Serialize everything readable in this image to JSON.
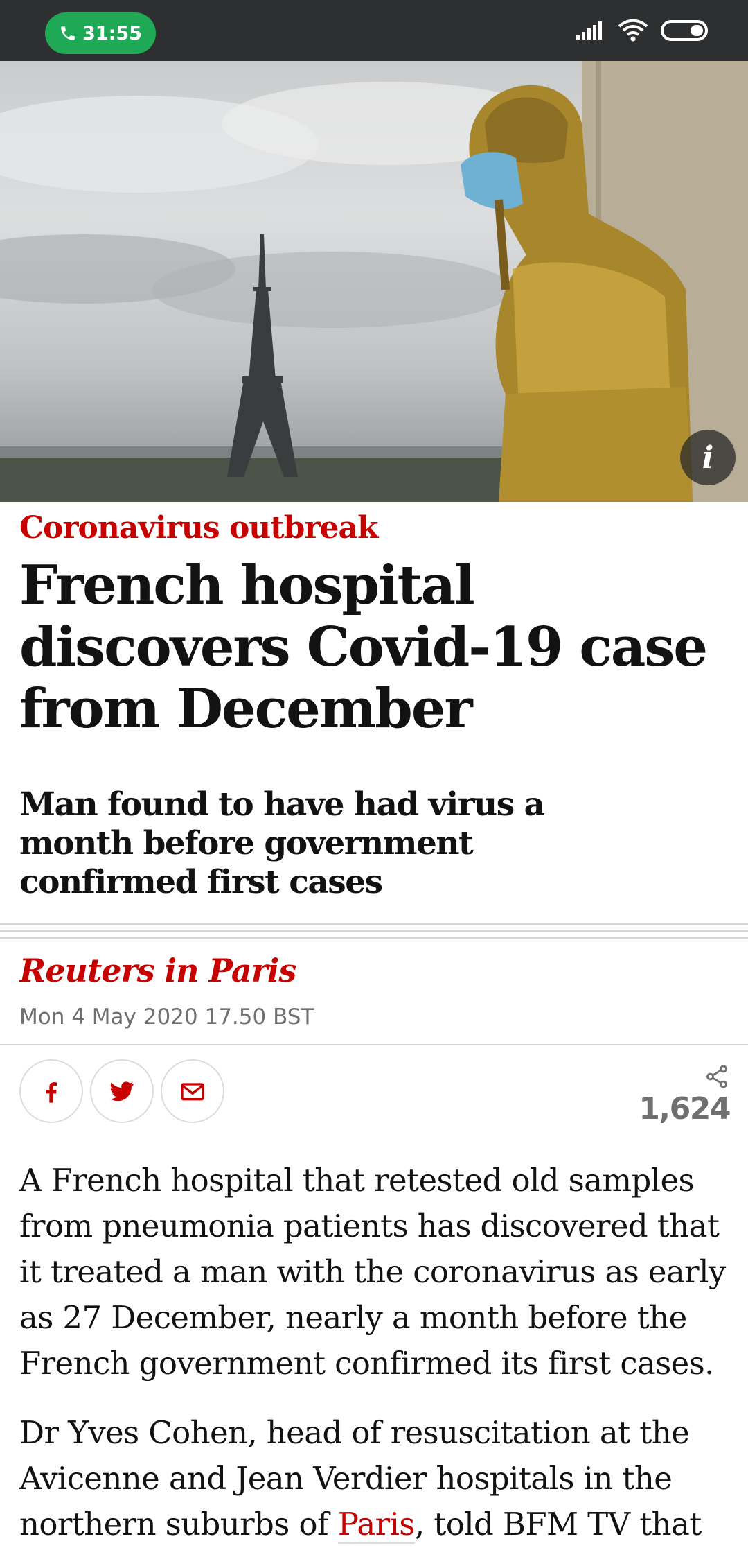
{
  "status_bar": {
    "call_timer": "31:55",
    "icons": [
      "phone-icon",
      "signal-icon",
      "wifi-icon",
      "battery-icon"
    ]
  },
  "hero": {
    "info_label": "i"
  },
  "article": {
    "kicker": "Coronavirus outbreak",
    "headline": "French hospital discovers Covid-19 case from December",
    "standfirst": "Man found to have had virus a month before government confirmed first cases",
    "byline": "Reuters in Paris",
    "dateline": "Mon 4 May 2020 17.50 BST",
    "share": {
      "buttons": [
        "facebook-icon",
        "twitter-icon",
        "email-icon"
      ],
      "count": "1,624"
    },
    "body": {
      "p1": "A French hospital that retested old samples from pneumonia patients has discovered that it treated a man with the coronavirus as early as 27 December, nearly a month before the French government confirmed its first cases.",
      "p2_before_link": "Dr Yves Cohen, head of resuscitation at the Avicenne and Jean Verdier hospitals in the northern suburbs of ",
      "p2_link": "Paris",
      "p2_after_link": ", told BFM TV that"
    }
  },
  "colors": {
    "accent": "#c70000",
    "status_bar": "#2d2f30",
    "call_pill": "#1fa855",
    "meta_grey": "#707070"
  }
}
